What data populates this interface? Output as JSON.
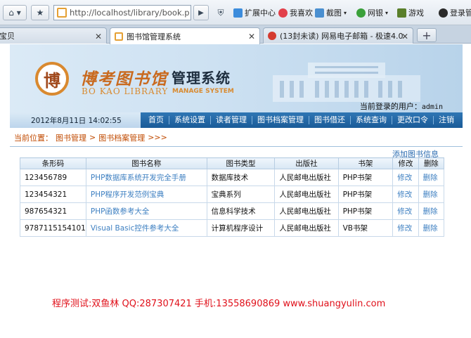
{
  "browser": {
    "url": "http://localhost/library/book.p",
    "extensions": [
      {
        "label": "扩展中心",
        "color": "#3c8cdc"
      },
      {
        "label": "我喜欢",
        "color": "#e2404a"
      },
      {
        "label": "截图",
        "color": "#4a8fd0"
      },
      {
        "label": "网银",
        "color": "#3aa03a"
      },
      {
        "label": "游戏",
        "color": "#5a7f2a"
      },
      {
        "label": "登录管家",
        "color": "#2a2a2a"
      }
    ],
    "tabs": [
      {
        "label": "宝贝",
        "active": false
      },
      {
        "label": "图书馆管理系统",
        "active": true
      },
      {
        "label": "(13封未读) 网易电子邮箱 - 极速4.0",
        "active": false
      }
    ]
  },
  "header": {
    "logo_seal": "博",
    "logo_cn": "博考图书馆",
    "logo_sys": "管理系统",
    "logo_en": "BO KAO LIBRARY",
    "logo_en_sys": "MANAGE SYSTEM",
    "user_label": "当前登录的用户：",
    "user_name": "admin"
  },
  "navbar": {
    "datetime": "2012年8月11日  14:02:55",
    "items": [
      "首页",
      "系统设置",
      "读者管理",
      "图书档案管理",
      "图书借还",
      "系统查询",
      "更改口令",
      "注销"
    ]
  },
  "breadcrumb": {
    "prefix": "当前位置：",
    "level1": "图书管理",
    "sep": ">",
    "level2": "图书档案管理",
    "tail": ">>>"
  },
  "add_link": "添加图书信息",
  "table": {
    "headers": [
      "条形码",
      "图书名称",
      "图书类型",
      "出版社",
      "书架",
      "修改",
      "删除"
    ],
    "rows": [
      {
        "barcode": "123456789",
        "name": "PHP数据库系统开发完全手册",
        "type": "数据库技术",
        "publisher": "人民邮电出版社",
        "shelf": "PHP书架",
        "edit": "修改",
        "delete": "删除"
      },
      {
        "barcode": "123454321",
        "name": "PHP程序开发范例宝典",
        "type": "宝典系列",
        "publisher": "人民邮电出版社",
        "shelf": "PHP书架",
        "edit": "修改",
        "delete": "删除"
      },
      {
        "barcode": "987654321",
        "name": "PHP函数参考大全",
        "type": "信息科学技术",
        "publisher": "人民邮电出版社",
        "shelf": "PHP书架",
        "edit": "修改",
        "delete": "删除"
      },
      {
        "barcode": "9787115154101",
        "name": "Visual Basic控件参考大全",
        "type": "计算机程序设计",
        "publisher": "人民邮电出版社",
        "shelf": "VB书架",
        "edit": "修改",
        "delete": "删除"
      }
    ]
  },
  "footer_note": "程序测试:双鱼林 QQ:287307421 手机:13558690869 www.shuangyulin.com"
}
